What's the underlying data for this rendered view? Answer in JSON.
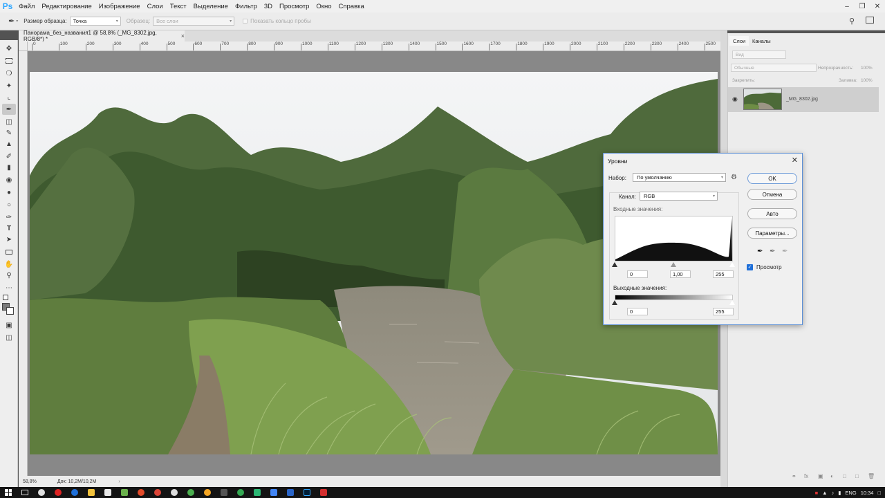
{
  "app": {
    "logo": "Ps",
    "menu": [
      "Файл",
      "Редактирование",
      "Изображение",
      "Слои",
      "Текст",
      "Выделение",
      "Фильтр",
      "3D",
      "Просмотр",
      "Окно",
      "Справка"
    ]
  },
  "options_bar": {
    "sample_size_label": "Размер образца:",
    "sample_size_value": "Точка",
    "sample_label": "Образец:",
    "sample_value": "Все слои",
    "show_ring_label": "Показать кольцо пробы"
  },
  "document": {
    "tab_title": "Панорама_без_названия1 @ 58,8% (_MG_8302.jpg, RGB/8*) *",
    "zoom": "58,8%",
    "doc_info": "Док: 10,2M/10,2M"
  },
  "ruler": {
    "top_labels": [
      "0",
      "100",
      "200",
      "300",
      "400",
      "500",
      "600",
      "700",
      "800",
      "900",
      "1000",
      "1100",
      "1200",
      "1300",
      "1400",
      "1500",
      "1600",
      "1700",
      "1800",
      "1900",
      "2000",
      "2100",
      "2200",
      "2300",
      "2400",
      "2500"
    ]
  },
  "layers_panel": {
    "tabs": [
      "Слои",
      "Каналы"
    ],
    "filter_placeholder": "Вид",
    "blend_mode": "Обычные",
    "opacity_label": "Непрозрачность:",
    "opacity_value": "100%",
    "lock_label": "Закрепить:",
    "fill_label": "Заливка:",
    "fill_value": "100%",
    "layer_name": "_MG_8302.jpg"
  },
  "levels_dialog": {
    "title": "Уровни",
    "preset_label": "Набор:",
    "preset_value": "По умолчанию",
    "channel_label": "Канал:",
    "channel_value": "RGB",
    "input_label": "Входные значения:",
    "input_black": "0",
    "input_gamma": "1,00",
    "input_white": "255",
    "output_label": "Выходные значения:",
    "output_black": "0",
    "output_white": "255",
    "ok": "OK",
    "cancel": "Отмена",
    "auto": "Авто",
    "options": "Параметры...",
    "preview_label": "Просмотр",
    "preview_checked": true
  },
  "taskbar": {
    "lang": "ENG",
    "time": "10:34"
  },
  "colors": {
    "accent": "#1e6fd9",
    "dialog_border": "#5b8fd6",
    "ps_blue": "#31a8ff"
  }
}
